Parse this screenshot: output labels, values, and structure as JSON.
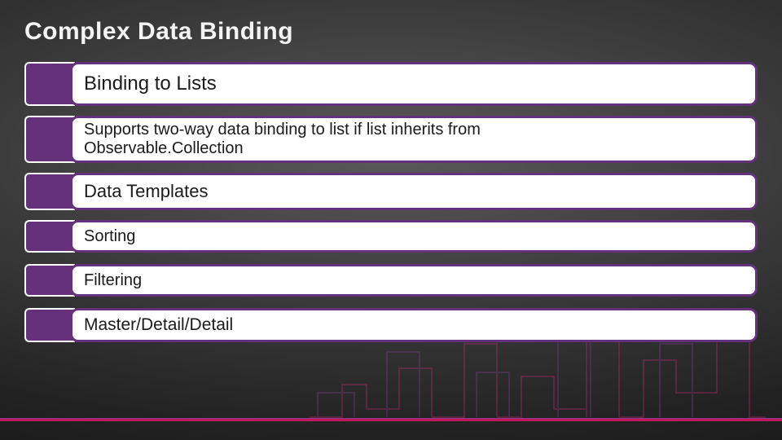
{
  "title": "Complex Data Binding",
  "items": [
    {
      "text": "Binding to Lists",
      "variant": "h-big"
    },
    {
      "text": "Supports two-way data binding to list if list inherits from Observable.Collection",
      "variant": "h-multi",
      "multiline": true
    },
    {
      "text": "Data Templates",
      "variant": "h-med"
    },
    {
      "text": "Sorting",
      "variant": "h-small"
    },
    {
      "text": "Filtering",
      "variant": "h-small"
    },
    {
      "text": "Master/Detail/Detail",
      "variant": "h-last"
    }
  ],
  "accent_purple": "#65317a",
  "accent_magenta": "#c2185b"
}
